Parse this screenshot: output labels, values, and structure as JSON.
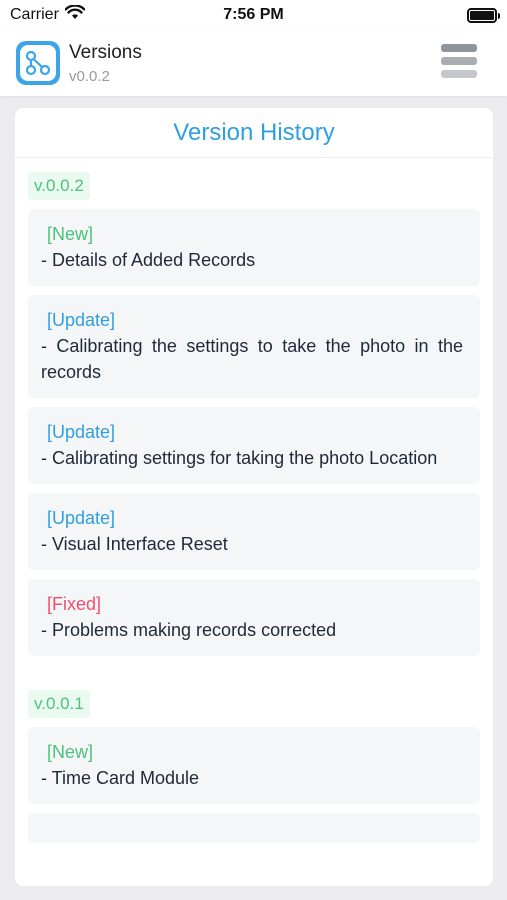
{
  "status_bar": {
    "carrier": "Carrier",
    "time": "7:56 PM"
  },
  "header": {
    "title": "Versions",
    "version": "v0.0.2",
    "logo_icon": "branch-icon",
    "menu_icon": "hamburger-menu-icon"
  },
  "page": {
    "title": "Version History"
  },
  "versions": [
    {
      "label": "v.0.0.2",
      "items": [
        {
          "tag": "[New]",
          "text": "- Details of Added Records"
        },
        {
          "tag": "[Update]",
          "text": "- Calibrating the settings to take the photo in the records"
        },
        {
          "tag": "[Update]",
          "text": "- Calibrating settings for taking the photo Location"
        },
        {
          "tag": "[Update]",
          "text": "- Visual Interface Reset"
        },
        {
          "tag": "[Fixed]",
          "text": "- Problems making records corrected"
        }
      ]
    },
    {
      "label": "v.0.0.1",
      "items": [
        {
          "tag": "[New]",
          "text": "- Time Card Module"
        }
      ]
    }
  ],
  "colors": {
    "accent": "#2f9fe0",
    "new": "#4cc27a",
    "update": "#2f9fe0",
    "fixed": "#f0506e"
  }
}
